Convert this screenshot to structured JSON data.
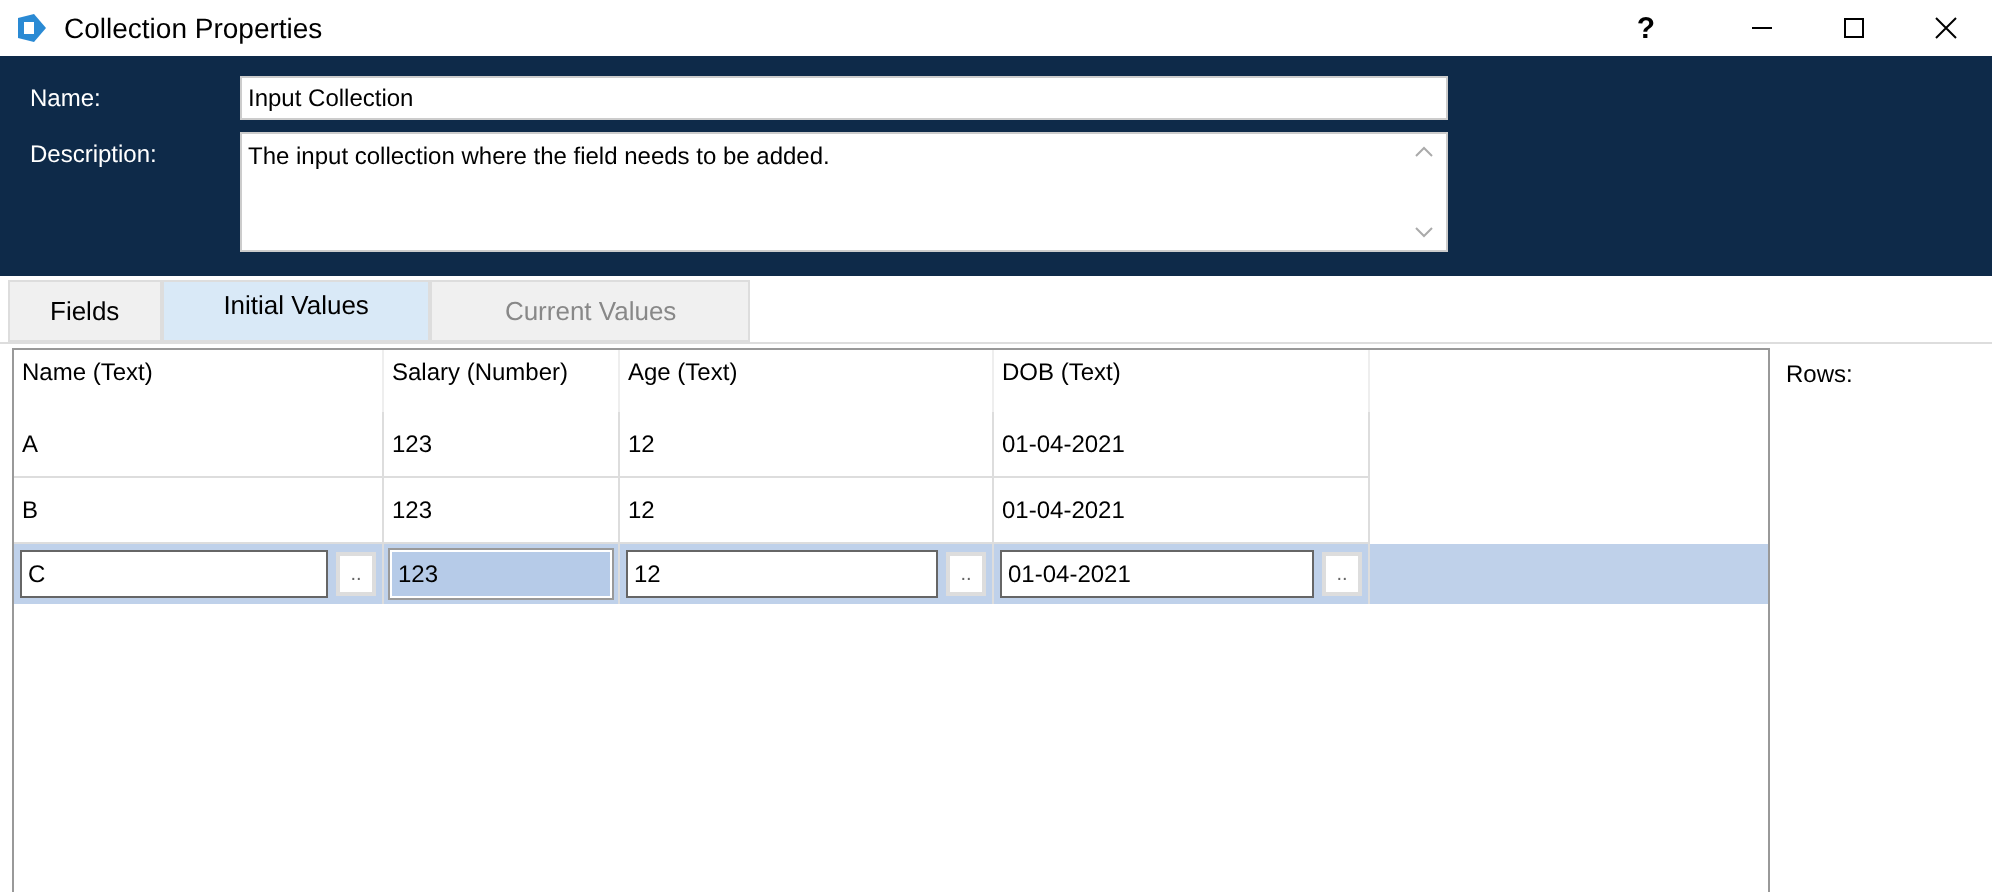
{
  "window": {
    "title": "Collection Properties",
    "help": "?"
  },
  "name_label": "Name:",
  "name_value": "Input Collection",
  "description_label": "Description:",
  "description_value": "The input collection where the field needs to be added.",
  "tabs": [
    {
      "label": "Fields",
      "selected": false,
      "disabled": false
    },
    {
      "label": "Initial Values",
      "selected": true,
      "disabled": false
    },
    {
      "label": "Current Values",
      "selected": false,
      "disabled": true
    }
  ],
  "table": {
    "columns": [
      "Name  (Text)",
      "Salary  (Number)",
      "Age  (Text)",
      "DOB  (Text)"
    ],
    "rows": [
      {
        "selected": false,
        "cells": [
          {
            "value": "A"
          },
          {
            "value": "123"
          },
          {
            "value": "12"
          },
          {
            "value": "01-04-2021"
          }
        ]
      },
      {
        "selected": false,
        "cells": [
          {
            "value": "B"
          },
          {
            "value": "123"
          },
          {
            "value": "12"
          },
          {
            "value": "01-04-2021"
          }
        ]
      },
      {
        "selected": true,
        "cells": [
          {
            "value": "C",
            "button": "..",
            "highlighted": false
          },
          {
            "value": "123",
            "highlighted": true
          },
          {
            "value": "12",
            "button": "..",
            "highlighted": false
          },
          {
            "value": "01-04-2021",
            "button": "..",
            "highlighted": false
          }
        ]
      }
    ]
  },
  "rows_label": "Rows:"
}
